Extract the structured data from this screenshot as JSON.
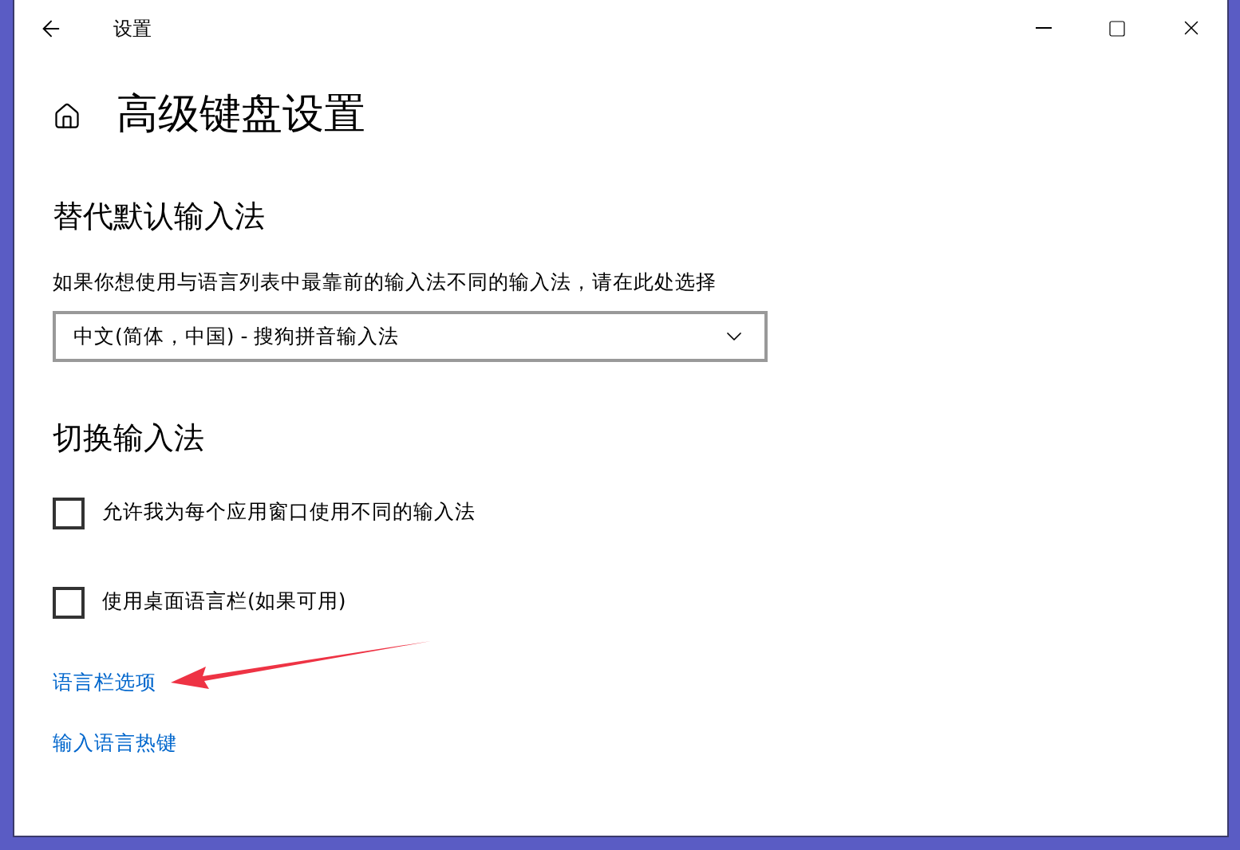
{
  "window": {
    "title": "设置"
  },
  "page": {
    "title": "高级键盘设置"
  },
  "override": {
    "heading": "替代默认输入法",
    "description": "如果你想使用与语言列表中最靠前的输入法不同的输入法，请在此处选择",
    "dropdown": {
      "value": "中文(简体，中国) - 搜狗拼音输入法"
    }
  },
  "switching": {
    "heading": "切换输入法",
    "checkboxes": [
      {
        "label": "允许我为每个应用窗口使用不同的输入法",
        "checked": false
      },
      {
        "label": "使用桌面语言栏(如果可用)",
        "checked": false
      }
    ],
    "links": [
      "语言栏选项",
      "输入语言热键"
    ]
  }
}
